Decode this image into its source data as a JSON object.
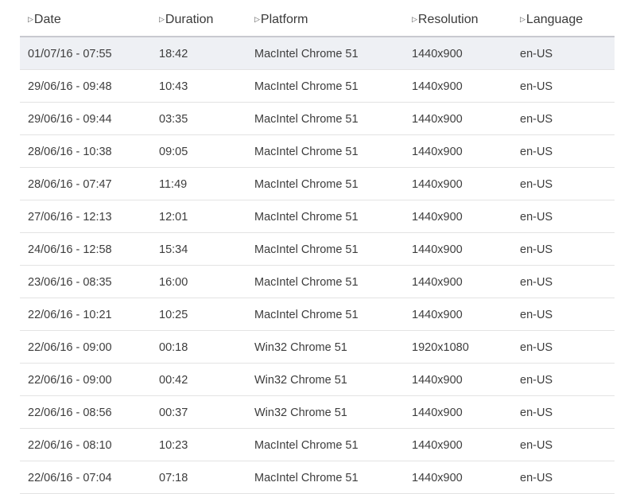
{
  "table": {
    "columns": [
      {
        "label": "Date",
        "icon": "sort-triangle-icon"
      },
      {
        "label": "Duration",
        "icon": "sort-triangle-icon"
      },
      {
        "label": "Platform",
        "icon": "sort-triangle-icon"
      },
      {
        "label": "Resolution",
        "icon": "sort-triangle-icon"
      },
      {
        "label": "Language",
        "icon": "sort-triangle-icon"
      }
    ],
    "sort_glyph": "▷",
    "rows": [
      [
        "01/07/16 - 07:55",
        "18:42",
        "MacIntel Chrome 51",
        "1440x900",
        "en-US"
      ],
      [
        "29/06/16 - 09:48",
        "10:43",
        "MacIntel Chrome 51",
        "1440x900",
        "en-US"
      ],
      [
        "29/06/16 - 09:44",
        "03:35",
        "MacIntel Chrome 51",
        "1440x900",
        "en-US"
      ],
      [
        "28/06/16 - 10:38",
        "09:05",
        "MacIntel Chrome 51",
        "1440x900",
        "en-US"
      ],
      [
        "28/06/16 - 07:47",
        "11:49",
        "MacIntel Chrome 51",
        "1440x900",
        "en-US"
      ],
      [
        "27/06/16 - 12:13",
        "12:01",
        "MacIntel Chrome 51",
        "1440x900",
        "en-US"
      ],
      [
        "24/06/16 - 12:58",
        "15:34",
        "MacIntel Chrome 51",
        "1440x900",
        "en-US"
      ],
      [
        "23/06/16 - 08:35",
        "16:00",
        "MacIntel Chrome 51",
        "1440x900",
        "en-US"
      ],
      [
        "22/06/16 - 10:21",
        "10:25",
        "MacIntel Chrome 51",
        "1440x900",
        "en-US"
      ],
      [
        "22/06/16 - 09:00",
        "00:18",
        "Win32 Chrome 51",
        "1920x1080",
        "en-US"
      ],
      [
        "22/06/16 - 09:00",
        "00:42",
        "Win32 Chrome 51",
        "1440x900",
        "en-US"
      ],
      [
        "22/06/16 - 08:56",
        "00:37",
        "Win32 Chrome 51",
        "1440x900",
        "en-US"
      ],
      [
        "22/06/16 - 08:10",
        "10:23",
        "MacIntel Chrome 51",
        "1440x900",
        "en-US"
      ],
      [
        "22/06/16 - 07:04",
        "07:18",
        "MacIntel Chrome 51",
        "1440x900",
        "en-US"
      ]
    ],
    "selected_row_index": 0,
    "colors": {
      "selected_row_bg": "#eef0f4",
      "header_border": "#c8c9d0",
      "row_border": "#e3e3e3",
      "text": "#3d3d3d"
    }
  }
}
